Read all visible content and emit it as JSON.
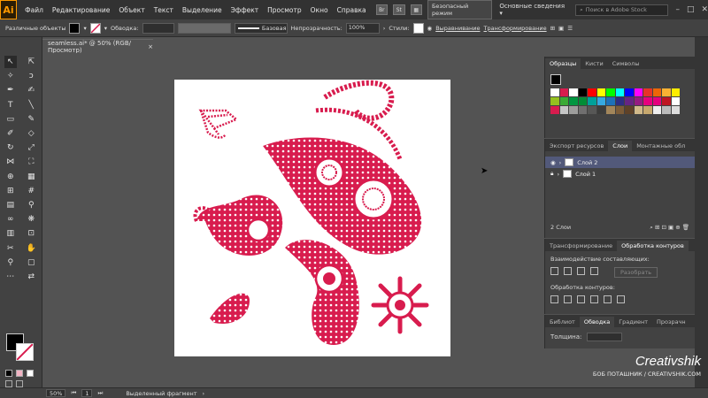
{
  "app": {
    "logo": "Ai",
    "menu": [
      "Файл",
      "Редактирование",
      "Объект",
      "Текст",
      "Выделение",
      "Эффект",
      "Просмотр",
      "Окно",
      "Справка"
    ],
    "menu_icons": [
      "Br",
      "St"
    ],
    "workspace_btn": "Безопасный режим",
    "workspace": "Основные сведения",
    "stock_search_placeholder": "Поиск в Adobe Stock"
  },
  "controlbar": {
    "selection": "Различные объекты",
    "stroke_label": "Обводка:",
    "stroke_style": "Базовая",
    "opacity_label": "Непрозрачность:",
    "opacity_value": "100%",
    "styles_label": "Стили:",
    "align": "Выравнивание",
    "transform": "Трансформирование"
  },
  "document": {
    "tab_title": "seamless.ai* @ 50% (RGB/Просмотр)",
    "close": "×"
  },
  "panels": {
    "swatches_tabs": [
      "Образцы",
      "Кисти",
      "Символы"
    ],
    "layers_tabs": [
      "Экспорт ресурсов",
      "Слои",
      "Монтажные обл"
    ],
    "layers": [
      {
        "name": "Слой 2",
        "selected": true
      },
      {
        "name": "Слой 1",
        "selected": false
      }
    ],
    "layers_count": "2 Слои",
    "pathfinder_tabs": [
      "Трансформирование",
      "Обработка контуров"
    ],
    "shape_modes_label": "Взаимодействие составляющих:",
    "expand_btn": "Разобрать",
    "pathfinders_label": "Обработка контуров:",
    "stroke_tabs": [
      "Библиот",
      "Обводка",
      "Градиент",
      "Прозрачн"
    ],
    "weight_label": "Толщина:"
  },
  "status": {
    "zoom": "50%",
    "artboard_num": "1",
    "selection_text": "Выделенный фрагмент"
  },
  "watermark": {
    "brand": "Creativshik",
    "sub": "БОБ ПОТАШНИК / CREATIVSHIK.COM"
  },
  "colors": {
    "accent": "#d81c4e",
    "layer_selected": "#52597a",
    "ui_dark": "#424242"
  }
}
